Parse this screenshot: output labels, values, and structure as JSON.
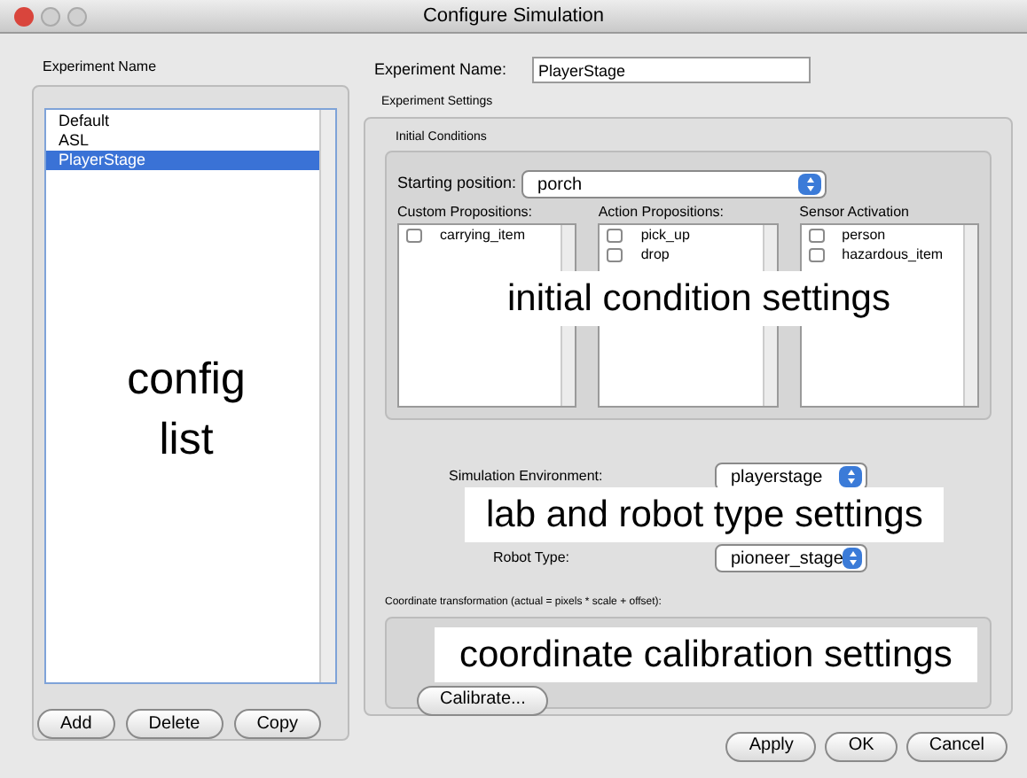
{
  "window": {
    "title": "Configure Simulation"
  },
  "experiment_list": {
    "title": "Experiment Name",
    "items": [
      {
        "label": "Default",
        "selected": false
      },
      {
        "label": "ASL",
        "selected": false
      },
      {
        "label": "PlayerStage",
        "selected": true
      }
    ],
    "buttons": [
      "Add",
      "Delete",
      "Copy"
    ]
  },
  "experiment_name": {
    "label": "Experiment Name:",
    "value": "PlayerStage"
  },
  "experiment_settings": {
    "title": "Experiment Settings",
    "initial_conditions": {
      "title": "Initial Conditions",
      "starting_position": {
        "label": "Starting position:",
        "value": "porch"
      },
      "lists": [
        {
          "title": "Custom Propositions:",
          "items": [
            {
              "label": "carrying_item",
              "checked": false
            }
          ]
        },
        {
          "title": "Action Propositions:",
          "items": [
            {
              "label": "pick_up",
              "checked": false
            },
            {
              "label": "drop",
              "checked": false
            }
          ]
        },
        {
          "title": "Sensor Activation",
          "items": [
            {
              "label": "person",
              "checked": false
            },
            {
              "label": "hazardous_item",
              "checked": false
            }
          ]
        }
      ]
    },
    "simulation_environment": {
      "label": "Simulation Environment:",
      "value": "playerstage"
    },
    "robot_type": {
      "label": "Robot Type:",
      "value": "pioneer_stage"
    },
    "coordinate_transformation": {
      "title": "Coordinate transformation (actual = pixels * scale + offset):",
      "button": "Calibrate..."
    }
  },
  "buttons": [
    "Apply",
    "OK",
    "Cancel"
  ],
  "annotations": [
    "config list",
    "initial condition settings",
    "lab and robot type settings",
    "coordinate calibration settings"
  ]
}
